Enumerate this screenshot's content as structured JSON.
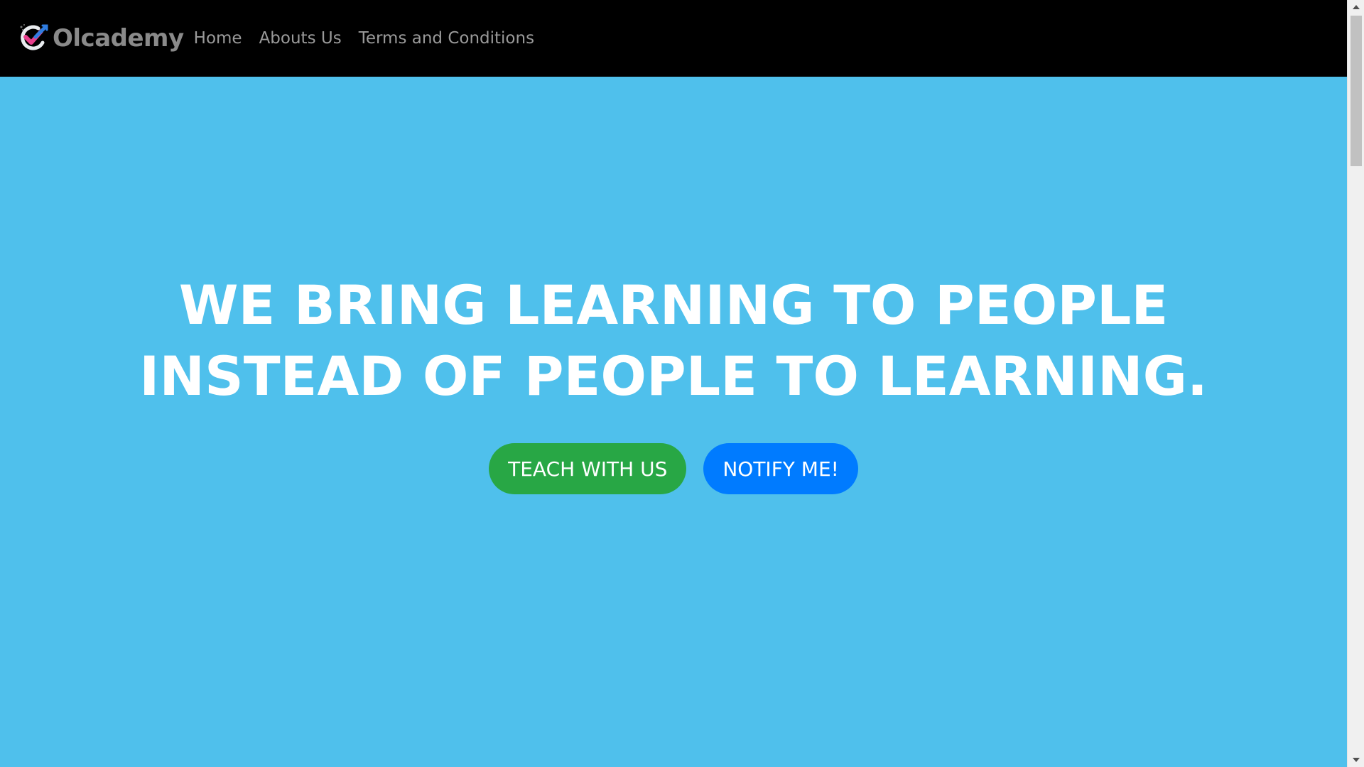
{
  "navbar": {
    "brand_name": "Olcademy",
    "logo_icon": "checkmark-logo-icon",
    "links": [
      {
        "label": "Home"
      },
      {
        "label": "Abouts Us"
      },
      {
        "label": "Terms and Conditions"
      }
    ]
  },
  "hero": {
    "title_line1": "WE BRING LEARNING TO PEOPLE",
    "title_line2": "INSTEAD OF PEOPLE TO LEARNING.",
    "background_color": "#4fc0ec",
    "buttons": {
      "teach_label": "TEACH WITH US",
      "teach_color": "#28a745",
      "notify_label": "NOTIFY ME!",
      "notify_color": "#007bff"
    }
  },
  "scrollbar": {
    "up_icon": "arrow-up-icon",
    "down_icon": "arrow-down-icon"
  }
}
